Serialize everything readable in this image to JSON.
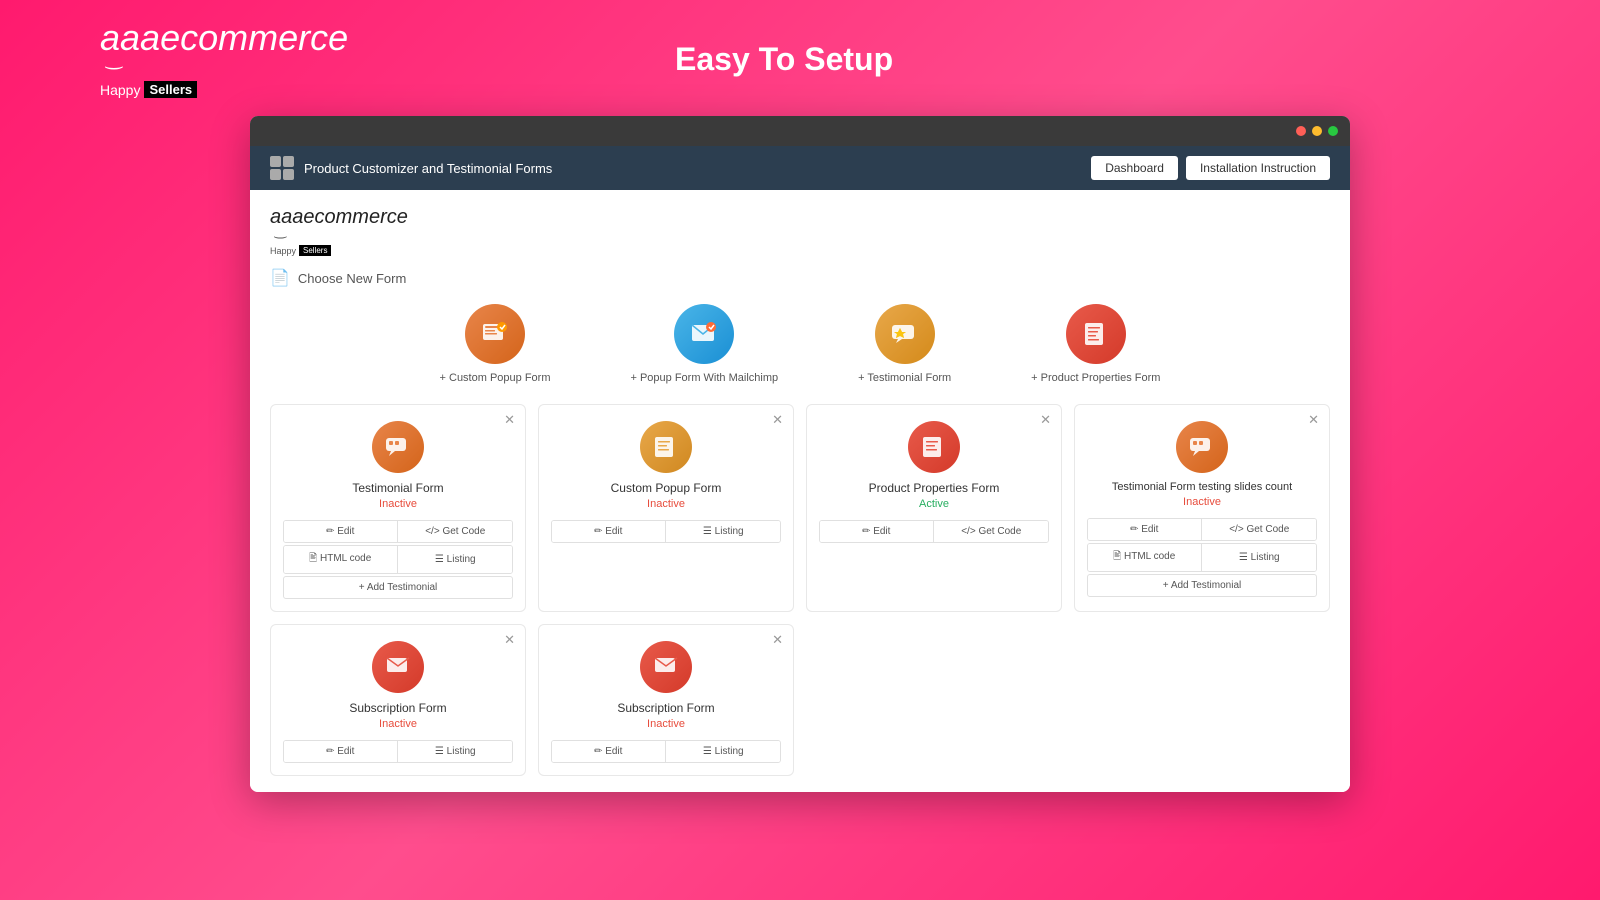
{
  "outer": {
    "page_title": "Easy To Setup",
    "brand": {
      "prefix": "aaa",
      "suffix": "ecommerce",
      "happy_text": "Happy",
      "sellers_text": "Sellers"
    }
  },
  "browser": {
    "titlebar_dots": [
      "red",
      "yellow",
      "green"
    ]
  },
  "app_header": {
    "title": "Product Customizer and Testimonial Forms",
    "dashboard_btn": "Dashboard",
    "installation_btn": "Installation Instruction"
  },
  "inner_brand": {
    "prefix": "aaa",
    "suffix": "ecommerce",
    "happy_text": "Happy",
    "sellers_text": "Sellers"
  },
  "choose_form": {
    "label": "Choose New Form"
  },
  "form_types": [
    {
      "label": "+ Custom Popup Form",
      "icon": "🖊️",
      "color": "orange"
    },
    {
      "label": "+ Popup Form With Mailchimp",
      "icon": "✓",
      "color": "blue"
    },
    {
      "label": "+ Testimonial Form",
      "icon": "⭐",
      "color": "amber"
    },
    {
      "label": "+ Product Properties Form",
      "icon": "📋",
      "color": "red"
    }
  ],
  "form_cards_row1": [
    {
      "title": "Testimonial Form",
      "status": "Inactive",
      "status_type": "inactive",
      "icon": "💬",
      "color": "orange",
      "actions_row1": [
        {
          "label": "✏ Edit"
        },
        {
          "label": "</> Get Code"
        }
      ],
      "actions_row2": [
        {
          "label": "🖹 HTML code"
        },
        {
          "label": "☰ Listing"
        }
      ],
      "extra_btn": "+ Add Testimonial"
    },
    {
      "title": "Custom Popup Form",
      "status": "Inactive",
      "status_type": "inactive",
      "icon": "📄",
      "color": "amber",
      "actions_row1": [
        {
          "label": "✏ Edit"
        },
        {
          "label": "☰ Listing"
        }
      ],
      "actions_row2": [],
      "extra_btn": null
    },
    {
      "title": "Product Properties Form",
      "status": "Active",
      "status_type": "active",
      "icon": "📋",
      "color": "red",
      "actions_row1": [
        {
          "label": "✏ Edit"
        },
        {
          "label": "</> Get Code"
        }
      ],
      "actions_row2": [],
      "extra_btn": null
    },
    {
      "title": "Testimonial Form testing slides count",
      "status": "Inactive",
      "status_type": "inactive",
      "icon": "💬",
      "color": "orange",
      "actions_row1": [
        {
          "label": "✏ Edit"
        },
        {
          "label": "</> Get Code"
        }
      ],
      "actions_row2": [
        {
          "label": "🖹 HTML code"
        },
        {
          "label": "☰ Listing"
        }
      ],
      "extra_btn": "+ Add Testimonial"
    }
  ],
  "form_cards_row2": [
    {
      "title": "Subscription Form",
      "status": "Inactive",
      "status_type": "inactive",
      "icon": "📧",
      "color": "red",
      "actions": [
        {
          "label": "✏ Edit"
        },
        {
          "label": "☰ Listing"
        }
      ]
    },
    {
      "title": "Subscription Form",
      "status": "Inactive",
      "status_type": "inactive",
      "icon": "📧",
      "color": "red",
      "actions": [
        {
          "label": "✏ Edit"
        },
        {
          "label": "☰ Listing"
        }
      ]
    }
  ]
}
